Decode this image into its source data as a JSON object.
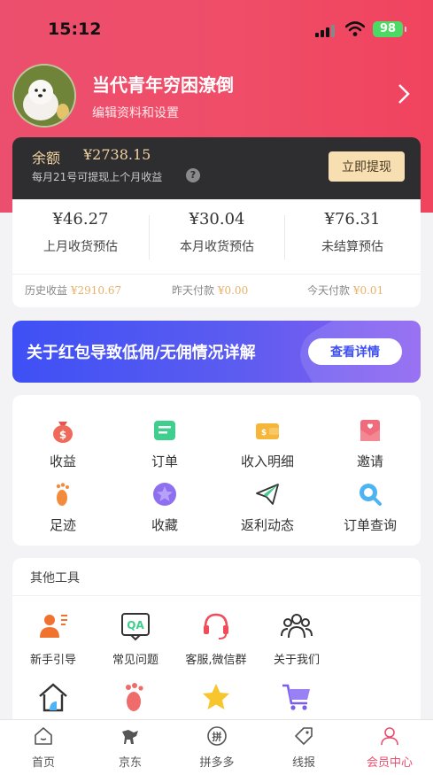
{
  "status_bar": {
    "time": "15:12",
    "battery": "98"
  },
  "profile": {
    "username": "当代青年穷困潦倒",
    "edit_label": "编辑资料和设置"
  },
  "balance": {
    "label": "余额",
    "amount": "¥2738.15",
    "note": "每月21号可提现上个月收益",
    "withdraw_label": "立即提现"
  },
  "stats": [
    {
      "value": "¥46.27",
      "label": "上月收货预估"
    },
    {
      "value": "¥30.04",
      "label": "本月收货预估"
    },
    {
      "value": "¥76.31",
      "label": "未结算预估"
    }
  ],
  "history": [
    {
      "label": "历史收益",
      "value": "¥2910.67"
    },
    {
      "label": "昨天付款",
      "value": "¥0.00"
    },
    {
      "label": "今天付款",
      "value": "¥0.01"
    }
  ],
  "banner": {
    "text": "关于红包导致低佣/无佣情况详解",
    "button": "查看详情"
  },
  "grid": [
    {
      "label": "收益",
      "icon": "money-bag-icon"
    },
    {
      "label": "订单",
      "icon": "order-icon"
    },
    {
      "label": "收入明细",
      "icon": "wallet-icon"
    },
    {
      "label": "邀请",
      "icon": "invite-envelope-icon"
    },
    {
      "label": "足迹",
      "icon": "footprint-icon"
    },
    {
      "label": "收藏",
      "icon": "star-icon"
    },
    {
      "label": "返利动态",
      "icon": "paper-plane-icon"
    },
    {
      "label": "订单查询",
      "icon": "search-icon"
    }
  ],
  "tools": {
    "title": "其他工具",
    "items": [
      {
        "label": "新手引导",
        "icon": "guide-icon"
      },
      {
        "label": "常见问题",
        "icon": "qa-icon"
      },
      {
        "label": "客服,微信群",
        "icon": "headset-icon"
      },
      {
        "label": "关于我们",
        "icon": "people-icon"
      },
      {
        "label": "",
        "icon": "home-icon"
      },
      {
        "label": "",
        "icon": "footprint-icon"
      },
      {
        "label": "",
        "icon": "star-icon"
      },
      {
        "label": "",
        "icon": "cart-icon"
      }
    ]
  },
  "tabbar": [
    {
      "label": "首页",
      "icon": "home-icon"
    },
    {
      "label": "京东",
      "icon": "jd-dog-icon"
    },
    {
      "label": "拼多多",
      "icon": "pdd-icon"
    },
    {
      "label": "线报",
      "icon": "tag-icon"
    },
    {
      "label": "会员中心",
      "icon": "user-icon",
      "active": true
    }
  ],
  "colors": {
    "accent": "#e94f6d",
    "gold": "#f0d3a0",
    "banner": "#3e50f5"
  }
}
